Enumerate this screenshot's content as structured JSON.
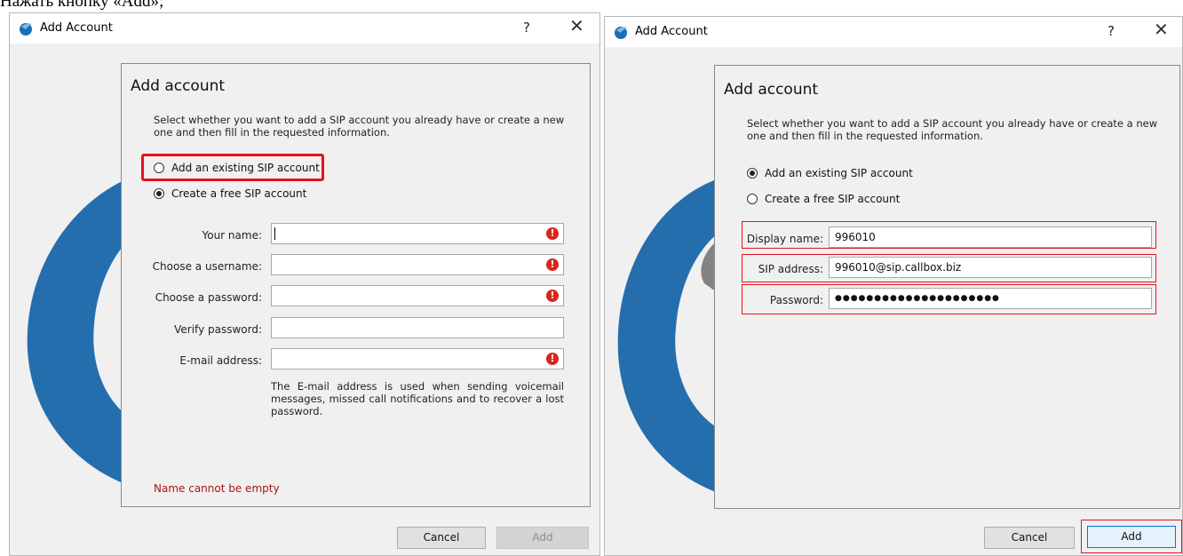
{
  "caption": "Нажать кнопку «Add»;",
  "left_window": {
    "title": "Add Account",
    "help": "?",
    "close": "✕",
    "panel_title": "Add account",
    "description": "Select whether you want to add a SIP account you already have or create a new one and then fill in the requested information.",
    "radio_existing": "Add an existing SIP account",
    "radio_create": "Create a free SIP account",
    "fields": [
      {
        "label": "Your name:",
        "value": "",
        "error": true
      },
      {
        "label": "Choose a username:",
        "value": "",
        "error": true
      },
      {
        "label": "Choose a password:",
        "value": "",
        "error": true
      },
      {
        "label": "Verify password:",
        "value": "",
        "error": false
      },
      {
        "label": "E-mail address:",
        "value": "",
        "error": true
      }
    ],
    "help_text": "The E-mail address is used when sending voicemail messages, missed call notifications and to recover a lost password.",
    "error_message": "Name cannot be empty",
    "cancel": "Cancel",
    "add": "Add"
  },
  "right_window": {
    "title": "Add Account",
    "help": "?",
    "close": "✕",
    "panel_title": "Add account",
    "description": "Select whether you want to add a SIP account you already have or create a new one and then fill in the requested information.",
    "radio_existing": "Add an existing SIP account",
    "radio_create": "Create a free SIP account",
    "display_name_label": "Display name:",
    "display_name_value": "996010",
    "sip_address_label": "SIP address:",
    "sip_address_value": "996010@sip.callbox.biz",
    "password_label": "Password:",
    "password_value": "●●●●●●●●●●●●●●●●●●●●●",
    "cancel": "Cancel",
    "add": "Add"
  },
  "colors": {
    "highlight": "#e1141e",
    "error_icon": "#d8261b",
    "error_text": "#a81414",
    "watermark_blue": "#1a6fb5"
  }
}
